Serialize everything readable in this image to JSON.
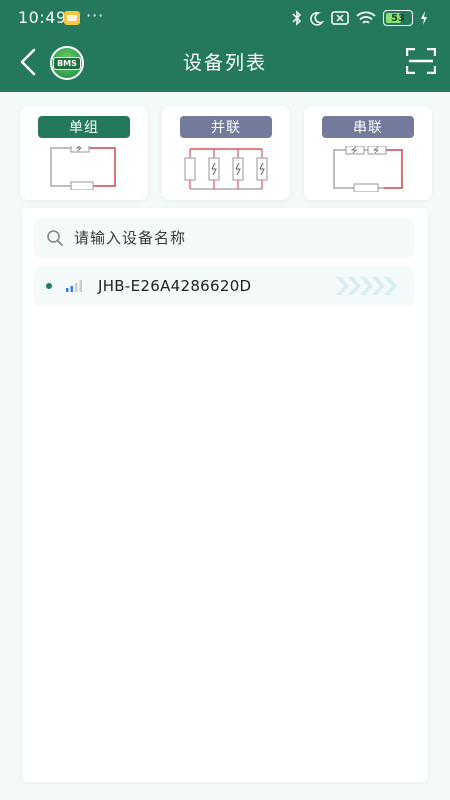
{
  "status_bar": {
    "time": "10:49",
    "more": "···",
    "battery_level": "53",
    "icons": [
      "app-notification-icon",
      "bluetooth-icon",
      "moon-icon",
      "sim-off-icon",
      "wifi-icon",
      "battery-icon",
      "charging-icon"
    ]
  },
  "header": {
    "title": "设备列表",
    "logo_text": "BMS",
    "color": "#24795c"
  },
  "modes": [
    {
      "label": "单组",
      "active": true
    },
    {
      "label": "并联",
      "active": false
    },
    {
      "label": "串联",
      "active": false
    }
  ],
  "search": {
    "placeholder": "请输入设备名称",
    "value": ""
  },
  "devices": [
    {
      "name": "JHB-E26A4286620D"
    }
  ],
  "colors": {
    "primary": "#24795c",
    "inactive_mode": "#737a9c",
    "wire_red": "#e0525a",
    "wire_gray": "#a8a8a8"
  }
}
